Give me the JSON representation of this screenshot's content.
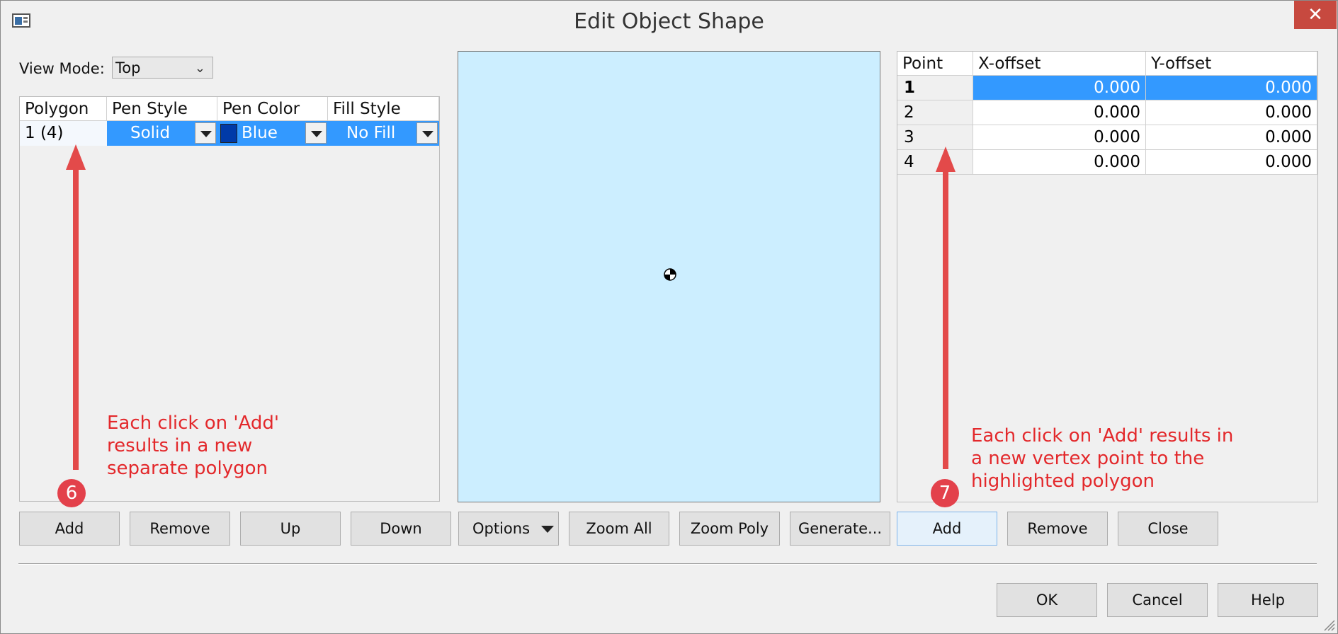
{
  "window": {
    "title": "Edit Object Shape",
    "close_glyph": "✕"
  },
  "view_mode": {
    "label": "View Mode:",
    "value": "Top"
  },
  "polygon_table": {
    "headers": [
      "Polygon",
      "Pen Style",
      "Pen Color",
      "Fill Style"
    ],
    "rows": [
      {
        "polygon": "1 (4)",
        "pen_style": "Solid",
        "pen_color": "Blue",
        "pen_color_hex": "#003aa8",
        "fill_style": "No Fill"
      }
    ]
  },
  "points_table": {
    "headers": [
      "Point",
      "X-offset",
      "Y-offset"
    ],
    "rows": [
      {
        "point": "1",
        "x": "0.000",
        "y": "0.000"
      },
      {
        "point": "2",
        "x": "0.000",
        "y": "0.000"
      },
      {
        "point": "3",
        "x": "0.000",
        "y": "0.000"
      },
      {
        "point": "4",
        "x": "0.000",
        "y": "0.000"
      }
    ]
  },
  "buttons": {
    "add_polygon": "Add",
    "remove_polygon": "Remove",
    "up": "Up",
    "down": "Down",
    "options": "Options",
    "zoom_all": "Zoom All",
    "zoom_poly": "Zoom Poly",
    "generate": "Generate...",
    "add_point": "Add",
    "remove_point": "Remove",
    "close": "Close",
    "ok": "OK",
    "cancel": "Cancel",
    "help": "Help"
  },
  "annotations": {
    "left": {
      "badge": "6",
      "lines": [
        "Each click on 'Add'",
        "results in a new",
        "separate polygon"
      ]
    },
    "right": {
      "badge": "7",
      "lines": [
        "Each click on 'Add' results in",
        "a new vertex point to the",
        "highlighted polygon"
      ]
    }
  },
  "colors": {
    "canvas": "#cceeff",
    "selection": "#3399ff",
    "annotation": "#e3282b"
  }
}
